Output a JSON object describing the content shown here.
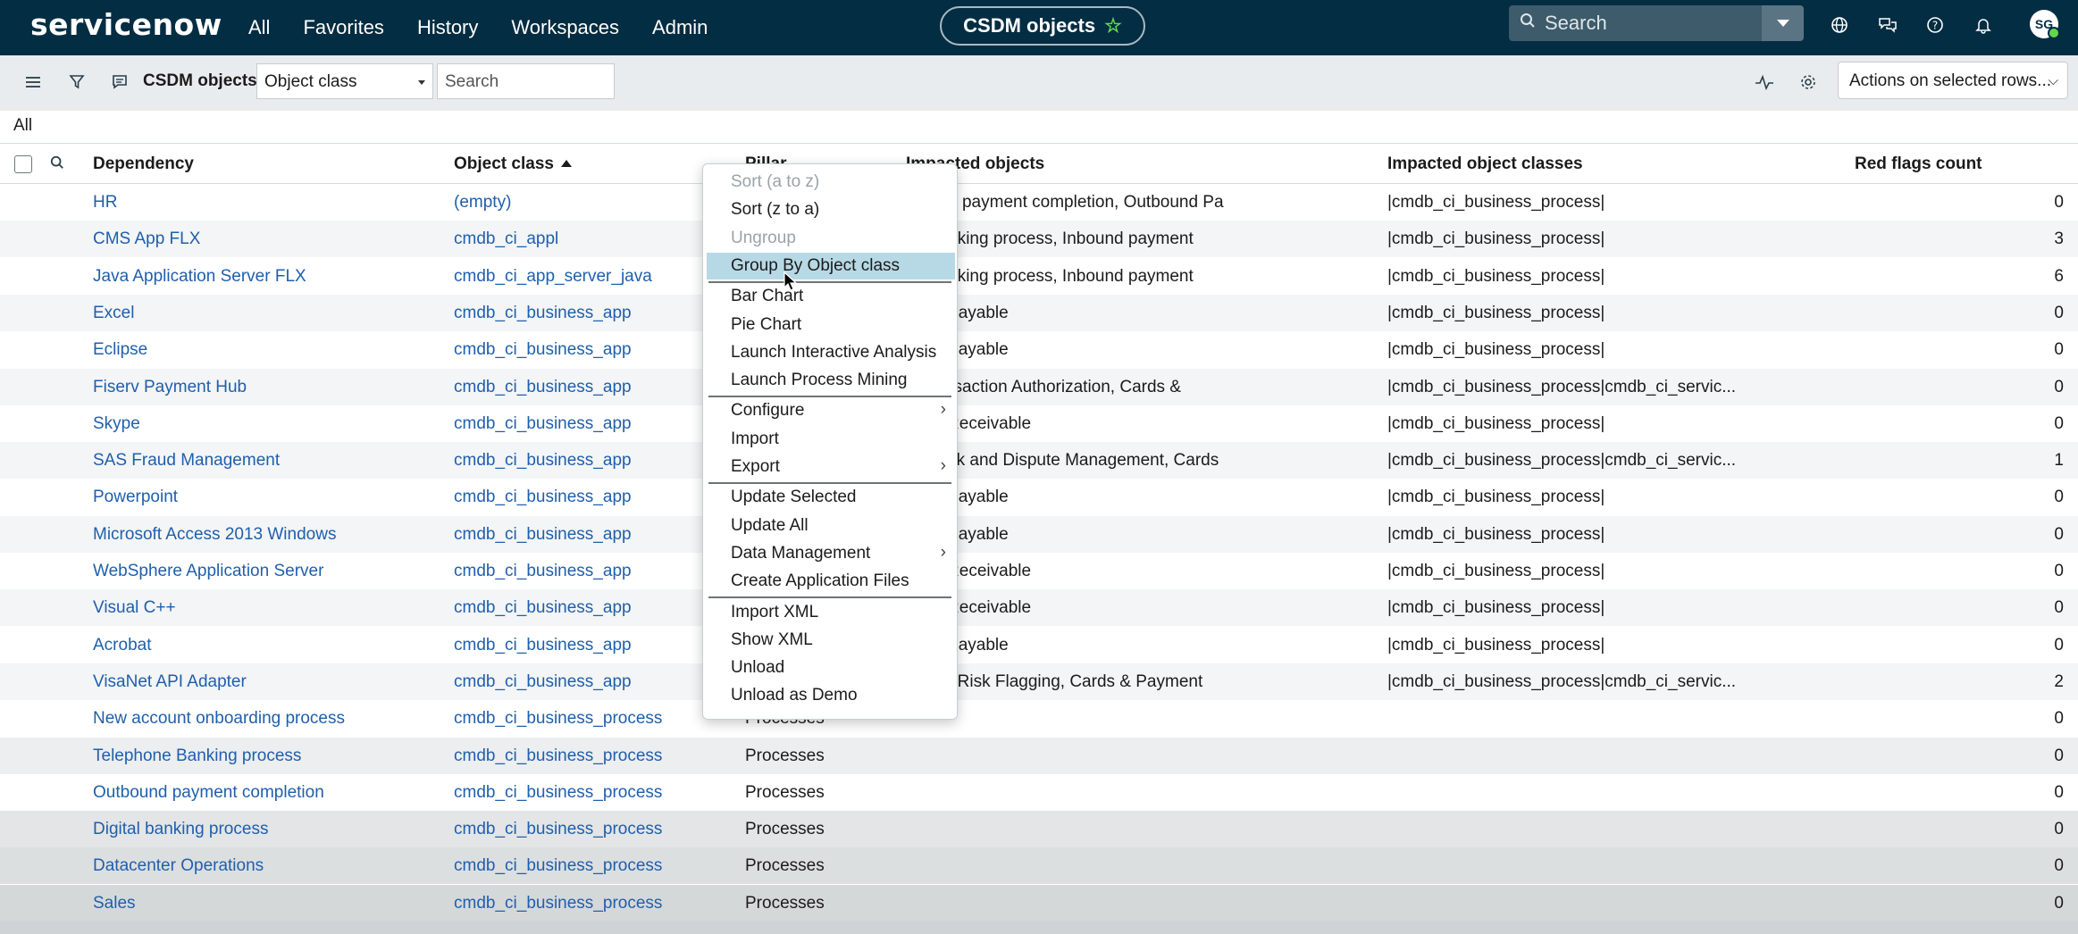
{
  "topnav": {
    "logo": "servicenow",
    "links": [
      "All",
      "Favorites",
      "History",
      "Workspaces",
      "Admin"
    ],
    "context_pill": "CSDM objects",
    "search_placeholder": "Search",
    "avatar_initials": "SG"
  },
  "toolbar": {
    "title": "CSDM objects",
    "field_select": "Object class",
    "search_placeholder": "Search",
    "actions_label": "Actions on selected rows..."
  },
  "breadcrumb": "All",
  "columns": {
    "dependency": "Dependency",
    "object_class": "Object class",
    "pillar": "Pillar",
    "impacted_objects": "Impacted objects",
    "impacted_object_classes": "Impacted object classes",
    "red_flags_count": "Red flags count"
  },
  "rows": [
    {
      "dependency": "HR",
      "object_class": "(empty)",
      "pillar": "",
      "impacted": "und payment completion, Outbound Pa",
      "classes": "|cmdb_ci_business_process|",
      "flags": "0"
    },
    {
      "dependency": "CMS App FLX",
      "object_class": "cmdb_ci_appl",
      "pillar": "",
      "impacted": "banking process, Inbound payment",
      "classes": "|cmdb_ci_business_process|",
      "flags": "3"
    },
    {
      "dependency": "Java Application Server FLX",
      "object_class": "cmdb_ci_app_server_java",
      "pillar": "",
      "impacted": "banking process, Inbound payment",
      "classes": "|cmdb_ci_business_process|",
      "flags": "6"
    },
    {
      "dependency": "Excel",
      "object_class": "cmdb_ci_business_app",
      "pillar": "",
      "impacted": "ts Payable",
      "classes": "|cmdb_ci_business_process|",
      "flags": "0"
    },
    {
      "dependency": "Eclipse",
      "object_class": "cmdb_ci_business_app",
      "pillar": "",
      "impacted": "ts Payable",
      "classes": "|cmdb_ci_business_process|",
      "flags": "0"
    },
    {
      "dependency": "Fiserv Payment Hub",
      "object_class": "cmdb_ci_business_app",
      "pillar": "",
      "impacted": "ransaction Authorization, Cards &",
      "classes": "|cmdb_ci_business_process|cmdb_ci_servic...",
      "flags": "0"
    },
    {
      "dependency": "Skype",
      "object_class": "cmdb_ci_business_app",
      "pillar": "",
      "impacted": "ts Receivable",
      "classes": "|cmdb_ci_business_process|",
      "flags": "0"
    },
    {
      "dependency": "SAS Fraud Management",
      "object_class": "cmdb_ci_business_app",
      "pillar": "",
      "impacted": "back and Dispute Management, Cards",
      "classes": "|cmdb_ci_business_process|cmdb_ci_servic...",
      "flags": "1"
    },
    {
      "dependency": "Powerpoint",
      "object_class": "cmdb_ci_business_app",
      "pillar": "",
      "impacted": "ts Payable",
      "classes": "|cmdb_ci_business_process|",
      "flags": "0"
    },
    {
      "dependency": "Microsoft Access 2013 Windows",
      "object_class": "cmdb_ci_business_app",
      "pillar": "",
      "impacted": "ts Payable",
      "classes": "|cmdb_ci_business_process|",
      "flags": "0"
    },
    {
      "dependency": "WebSphere Application Server",
      "object_class": "cmdb_ci_business_app",
      "pillar": "",
      "impacted": "ts Receivable",
      "classes": "|cmdb_ci_business_process|",
      "flags": "0"
    },
    {
      "dependency": "Visual C++",
      "object_class": "cmdb_ci_business_app",
      "pillar": "",
      "impacted": "ts Receivable",
      "classes": "|cmdb_ci_business_process|",
      "flags": "0"
    },
    {
      "dependency": "Acrobat",
      "object_class": "cmdb_ci_business_app",
      "pillar": "",
      "impacted": "ts Payable",
      "classes": "|cmdb_ci_business_process|",
      "flags": "0"
    },
    {
      "dependency": "VisaNet API Adapter",
      "object_class": "cmdb_ci_business_app",
      "pillar": "",
      "impacted": "me Risk Flagging, Cards & Payment",
      "classes": "|cmdb_ci_business_process|cmdb_ci_servic...",
      "flags": "2"
    },
    {
      "dependency": "New account onboarding process",
      "object_class": "cmdb_ci_business_process",
      "pillar": "Processes",
      "impacted": "",
      "classes": "",
      "flags": "0"
    },
    {
      "dependency": "Telephone Banking process",
      "object_class": "cmdb_ci_business_process",
      "pillar": "Processes",
      "impacted": "",
      "classes": "",
      "flags": "0"
    },
    {
      "dependency": "Outbound payment completion",
      "object_class": "cmdb_ci_business_process",
      "pillar": "Processes",
      "impacted": "",
      "classes": "",
      "flags": "0"
    },
    {
      "dependency": "Digital banking process",
      "object_class": "cmdb_ci_business_process",
      "pillar": "Processes",
      "impacted": "",
      "classes": "",
      "flags": "0"
    },
    {
      "dependency": "Datacenter Operations",
      "object_class": "cmdb_ci_business_process",
      "pillar": "Processes",
      "impacted": "",
      "classes": "",
      "flags": "0"
    },
    {
      "dependency": "Sales",
      "object_class": "cmdb_ci_business_process",
      "pillar": "Processes",
      "impacted": "",
      "classes": "",
      "flags": "0"
    }
  ],
  "context_menu": {
    "items": [
      {
        "label": "Sort (a to z)",
        "disabled": true
      },
      {
        "label": "Sort (z to a)"
      },
      {
        "label": "Ungroup",
        "disabled": true
      },
      {
        "label": "Group By Object class",
        "highlighted": true
      },
      {
        "label": "Bar Chart"
      },
      {
        "label": "Pie Chart"
      },
      {
        "label": "Launch Interactive Analysis"
      },
      {
        "label": "Launch Process Mining"
      },
      {
        "label": "Configure",
        "submenu": true
      },
      {
        "label": "Import"
      },
      {
        "label": "Export",
        "submenu": true
      },
      {
        "label": "Update Selected"
      },
      {
        "label": "Update All"
      },
      {
        "label": "Data Management",
        "submenu": true
      },
      {
        "label": "Create Application Files"
      },
      {
        "label": "Import XML"
      },
      {
        "label": "Show XML"
      },
      {
        "label": "Unload"
      },
      {
        "label": "Unload as Demo"
      }
    ]
  },
  "colors": {
    "nav_bg": "#032d42",
    "link": "#1f5fad",
    "menu_highlight": "#b7d9e6",
    "favorite_star": "#62d84e"
  },
  "icons": [
    "search-icon",
    "globe-icon",
    "chat-icon",
    "help-icon",
    "bell-icon",
    "hamburger-icon",
    "filter-icon",
    "comment-icon",
    "pulse-icon",
    "gear-icon",
    "star-icon"
  ]
}
